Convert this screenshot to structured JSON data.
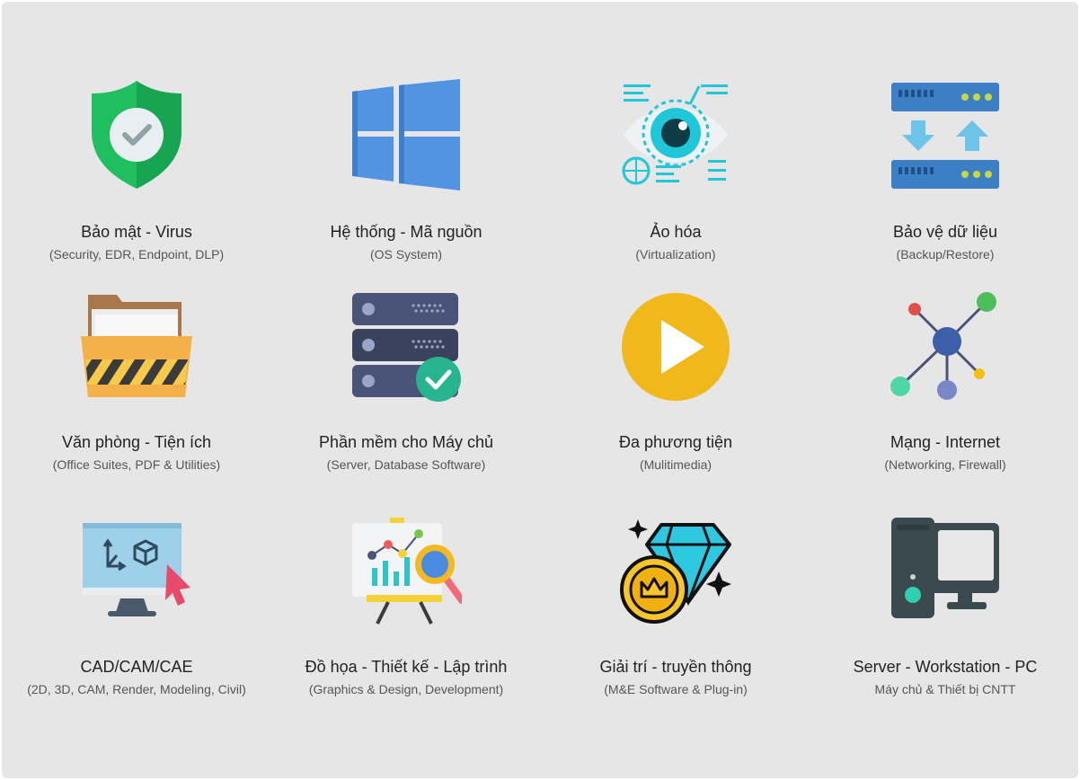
{
  "categories": [
    {
      "title": "Bảo mật - Virus",
      "subtitle": "(Security, EDR, Endpoint, DLP)",
      "icon": "shield-check-icon"
    },
    {
      "title": "Hệ thống - Mã nguồn",
      "subtitle": "(OS System)",
      "icon": "windows-logo-icon"
    },
    {
      "title": "Ảo hóa",
      "subtitle": "(Virtualization)",
      "icon": "eye-virtualization-icon"
    },
    {
      "title": "Bảo vệ dữ liệu",
      "subtitle": "(Backup/Restore)",
      "icon": "backup-restore-icon"
    },
    {
      "title": "Văn phòng - Tiện ích",
      "subtitle": "(Office Suites, PDF & Utilities)",
      "icon": "folder-icon"
    },
    {
      "title": "Phần mềm cho Máy chủ",
      "subtitle": "(Server, Database Software)",
      "icon": "server-check-icon"
    },
    {
      "title": "Đa phương tiện",
      "subtitle": "(Mulitimedia)",
      "icon": "play-icon"
    },
    {
      "title": "Mạng - Internet",
      "subtitle": "(Networking, Firewall)",
      "icon": "network-icon"
    },
    {
      "title": "CAD/CAM/CAE",
      "subtitle": "(2D, 3D, CAM, Render, Modeling, Civil)",
      "icon": "cad-monitor-icon"
    },
    {
      "title": "Đồ họa - Thiết kế - Lập trình",
      "subtitle": "(Graphics & Design, Development)",
      "icon": "design-board-icon"
    },
    {
      "title": "Giải trí - truyền thông",
      "subtitle": "(M&E Software & Plug-in)",
      "icon": "diamond-coin-icon"
    },
    {
      "title": "Server - Workstation - PC",
      "subtitle": "Máy  chủ & Thiết bị CNTT",
      "icon": "desktop-pc-icon"
    }
  ],
  "colors": {
    "background": "#e6e6e6",
    "title_text": "#222222",
    "subtitle_text": "#555555"
  }
}
